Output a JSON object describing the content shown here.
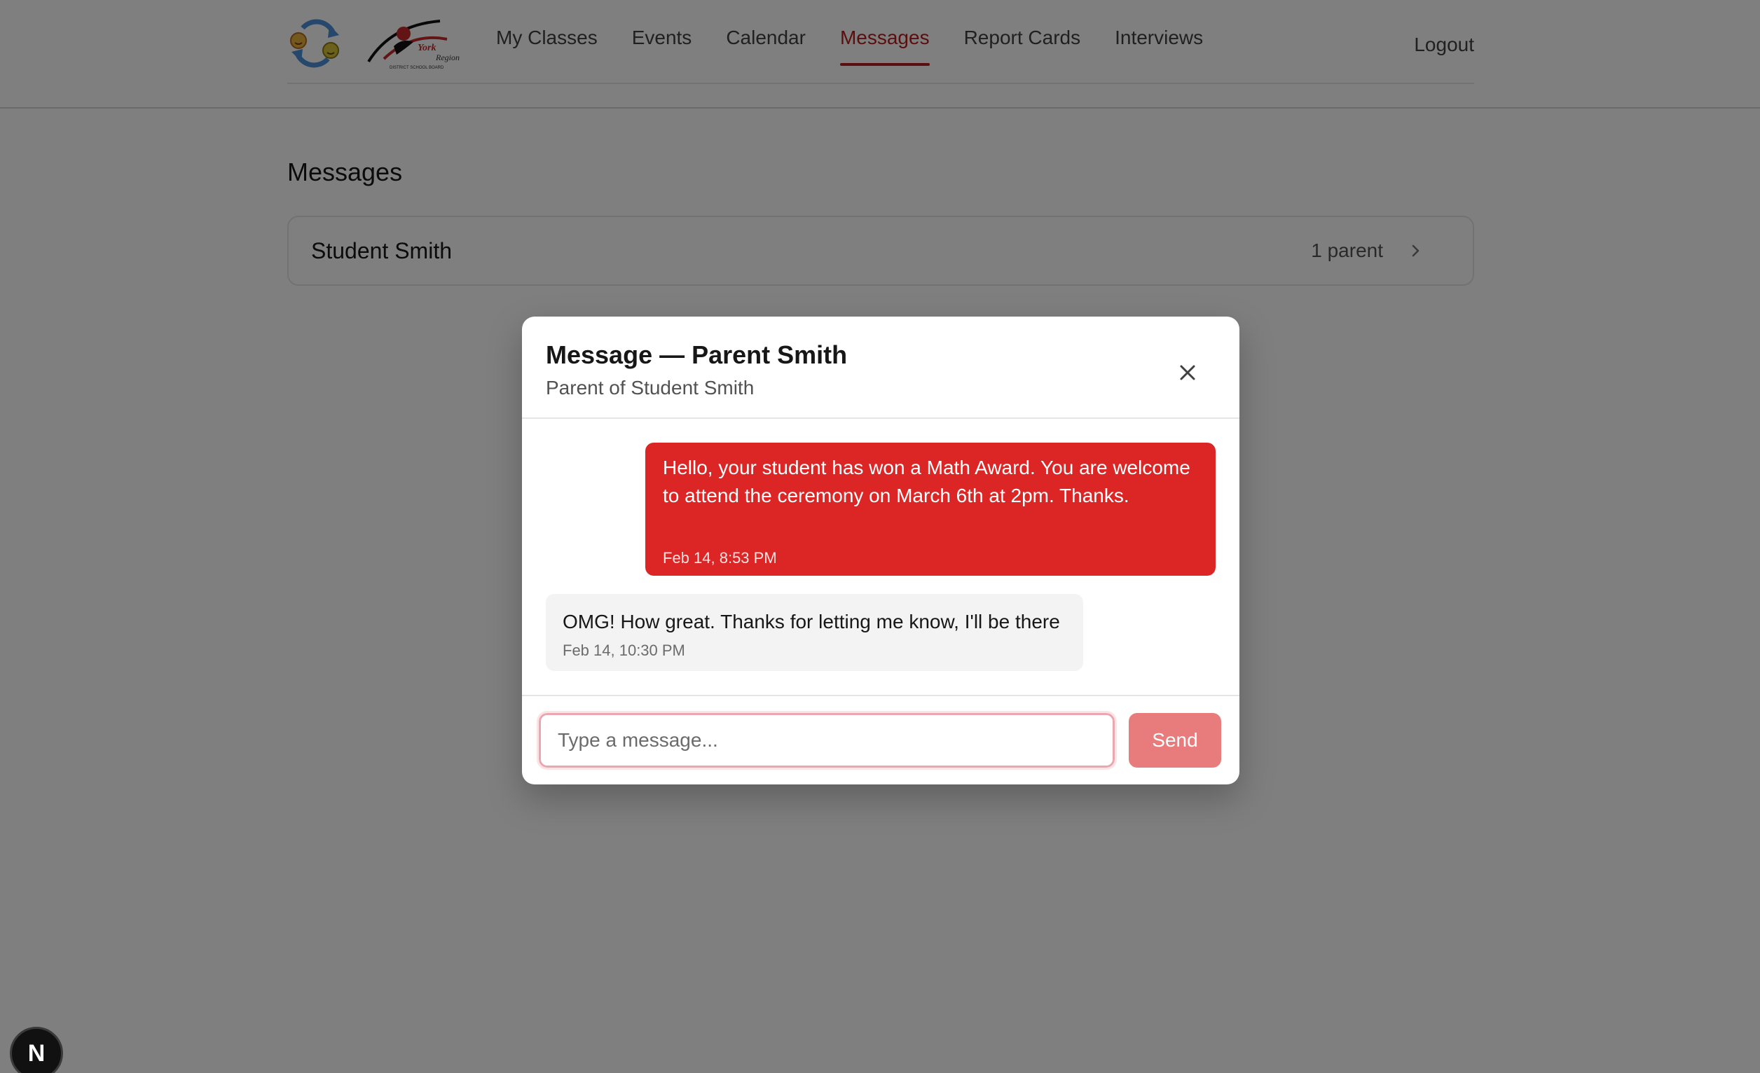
{
  "nav": {
    "items": [
      {
        "label": "My Classes",
        "active": false
      },
      {
        "label": "Events",
        "active": false
      },
      {
        "label": "Calendar",
        "active": false
      },
      {
        "label": "Messages",
        "active": true
      },
      {
        "label": "Report Cards",
        "active": false
      },
      {
        "label": "Interviews",
        "active": false
      }
    ],
    "logout_label": "Logout",
    "logos": [
      "exchange-logo",
      "york-region-district-school-board-logo"
    ]
  },
  "main": {
    "title": "Messages",
    "conversations": [
      {
        "name": "Student Smith",
        "count_label": "1 parent",
        "icon": "chevron-right-icon"
      }
    ]
  },
  "modal": {
    "title": "Message — Parent Smith",
    "subtitle": "Parent of Student Smith",
    "close_icon": "close-icon",
    "messages": [
      {
        "direction": "sent",
        "body": "Hello, your student has won a Math Award. You are welcome to attend the ceremony on March 6th at 2pm. Thanks.",
        "time": "Feb 14, 8:53 PM"
      },
      {
        "direction": "received",
        "body": "OMG! How great. Thanks for letting me know, I'll be there",
        "time": "Feb 14, 10:30 PM"
      }
    ],
    "input": {
      "placeholder": "Type a message...",
      "value": ""
    },
    "send_label": "Send"
  },
  "dev_badge": {
    "label": "N"
  },
  "colors": {
    "accent": "#b91c1c",
    "sent_bubble": "#dc2626",
    "received_bubble": "#f3f3f3",
    "send_button": "#e87b7b",
    "overlay": "rgba(0,0,0,0.5)"
  }
}
